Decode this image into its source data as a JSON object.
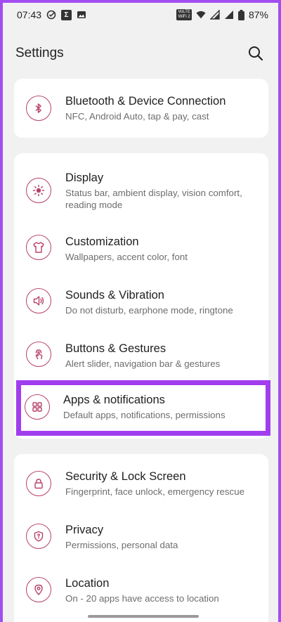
{
  "status": {
    "time": "07:43",
    "battery": "87%",
    "volte_top": "VoLTE",
    "volte_bottom": "WiFi 2"
  },
  "header": {
    "title": "Settings"
  },
  "cards": [
    {
      "items": [
        {
          "title": "Bluetooth & Device Connection",
          "subtitle": "NFC, Android Auto, tap & pay, cast",
          "icon": "bluetooth-icon"
        }
      ]
    },
    {
      "items": [
        {
          "title": "Display",
          "subtitle": "Status bar, ambient display, vision comfort, reading mode",
          "icon": "brightness-icon"
        },
        {
          "title": "Customization",
          "subtitle": "Wallpapers, accent color, font",
          "icon": "tshirt-icon"
        },
        {
          "title": "Sounds & Vibration",
          "subtitle": "Do not disturb, earphone mode, ringtone",
          "icon": "speaker-icon"
        },
        {
          "title": "Buttons & Gestures",
          "subtitle": "Alert slider, navigation bar & gestures",
          "icon": "gesture-icon"
        },
        {
          "title": "Apps & notifications",
          "subtitle": "Default apps, notifications, permissions",
          "icon": "apps-grid-icon"
        }
      ]
    },
    {
      "items": [
        {
          "title": "Security & Lock Screen",
          "subtitle": "Fingerprint, face unlock, emergency rescue",
          "icon": "lock-icon"
        },
        {
          "title": "Privacy",
          "subtitle": "Permissions, personal data",
          "icon": "privacy-shield-icon"
        },
        {
          "title": "Location",
          "subtitle": "On - 20 apps have access to location",
          "icon": "location-pin-icon"
        }
      ]
    }
  ],
  "colors": {
    "accent": "#b8426a",
    "highlight": "#a13dee"
  }
}
